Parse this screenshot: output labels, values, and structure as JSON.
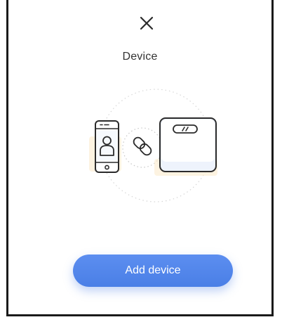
{
  "dialog": {
    "title": "Device",
    "close_icon": "close-icon",
    "add_button_label": "Add device"
  },
  "illustration": {
    "phone_icon": "phone-user-icon",
    "link_icon": "link-icon",
    "scale_icon": "scale-icon"
  },
  "colors": {
    "accent": "#4a7fe6",
    "icon_stroke": "#2b2b2b",
    "shadow_accent": "#f7d9a4",
    "tint_fill": "#e5eefb"
  }
}
